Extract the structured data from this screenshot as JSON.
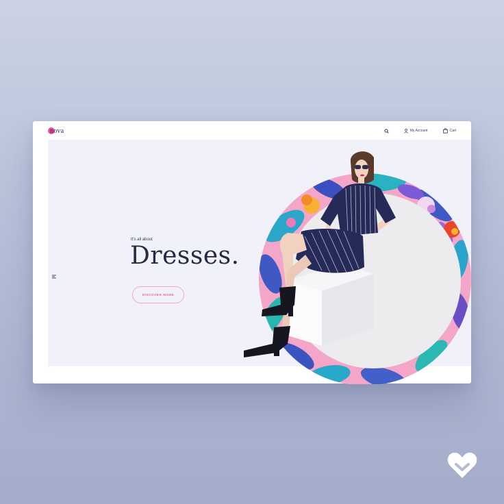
{
  "brand": {
    "logo_text": "nova",
    "accent": "#e4519a"
  },
  "nav": {
    "search_icon": "search-icon",
    "account_icon": "user-icon",
    "account_label": "My Account",
    "cart_icon": "shopping-bag-icon",
    "cart_label": "Cart"
  },
  "hero": {
    "eyebrow": "It's all about",
    "headline": "Dresses.",
    "cta_label": "DISCOVER MORE",
    "cta_color": "#e8629e",
    "background": "#f1f2f9",
    "side_icon": "menu-lines-icon"
  },
  "overlay": {
    "heart_icon": "heart-logo-icon"
  }
}
